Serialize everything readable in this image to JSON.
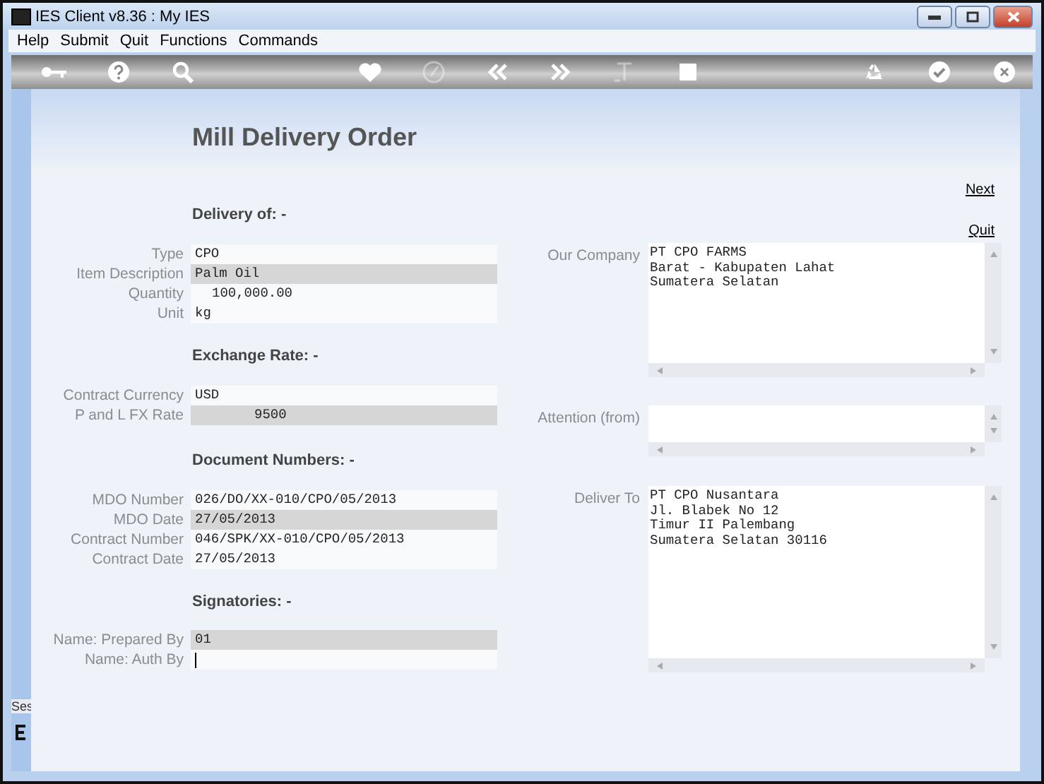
{
  "window": {
    "title": "IES Client v8.36 : My IES"
  },
  "menu": [
    "Help",
    "Submit",
    "Quit",
    "Functions",
    "Commands"
  ],
  "toolbar": [
    {
      "kind": "key",
      "disabled": false
    },
    {
      "kind": "help",
      "disabled": false
    },
    {
      "kind": "search",
      "disabled": false
    },
    {
      "kind": "heart",
      "disabled": false
    },
    {
      "kind": "clock",
      "disabled": true
    },
    {
      "kind": "back",
      "disabled": false
    },
    {
      "kind": "forward",
      "disabled": false
    },
    {
      "kind": "text",
      "disabled": true
    },
    {
      "kind": "stop",
      "disabled": false
    },
    {
      "kind": "recycle",
      "disabled": false
    },
    {
      "kind": "ok",
      "disabled": false
    },
    {
      "kind": "close",
      "disabled": false
    }
  ],
  "form": {
    "title": "Mill Delivery Order",
    "links": [
      "Next",
      "Quit"
    ],
    "sections": [
      {
        "heading": "Delivery of: -",
        "fields": [
          {
            "label": "Type",
            "value": "CPO",
            "kind": "text",
            "highlighted": false,
            "focused": false
          },
          {
            "label": "Item Description",
            "value": "Palm Oil",
            "kind": "text",
            "highlighted": true,
            "focused": false
          },
          {
            "label": "Quantity",
            "value": "100,000.00",
            "kind": "number",
            "highlighted": false,
            "focused": false
          },
          {
            "label": "Unit",
            "value": "kg",
            "kind": "text",
            "highlighted": false,
            "focused": false
          }
        ]
      },
      {
        "heading": "Exchange Rate: -",
        "fields": [
          {
            "label": "Contract Currency",
            "value": "USD",
            "kind": "text",
            "highlighted": false,
            "focused": false
          },
          {
            "label": "P and L  FX Rate",
            "value": "9500",
            "kind": "rate",
            "highlighted": true,
            "focused": false
          }
        ]
      },
      {
        "heading": "Document Numbers: -",
        "fields": [
          {
            "label": "MDO Number",
            "value": "026/DO/XX-010/CPO/05/2013",
            "kind": "text",
            "highlighted": false,
            "focused": false
          },
          {
            "label": "MDO Date",
            "value": "27/05/2013",
            "kind": "text",
            "highlighted": true,
            "focused": false
          },
          {
            "label": "Contract Number",
            "value": "046/SPK/XX-010/CPO/05/2013",
            "kind": "text",
            "highlighted": false,
            "focused": false
          },
          {
            "label": "Contract Date",
            "value": "27/05/2013",
            "kind": "text",
            "highlighted": false,
            "focused": false
          }
        ]
      },
      {
        "heading": "Signatories: -",
        "fields": [
          {
            "label": "Name: Prepared By",
            "value": "01",
            "kind": "text",
            "highlighted": true,
            "focused": false
          },
          {
            "label": "Name: Auth By",
            "kind": "text",
            "highlighted": false,
            "focused": true
          }
        ]
      }
    ],
    "memos": [
      {
        "label": "Our Company",
        "lines": [
          "PT CPO FARMS",
          "Barat - Kabupaten Lahat",
          "Sumatera Selatan"
        ]
      },
      {
        "label": "Attention (from)"
      },
      {
        "label": "Deliver To",
        "lines": [
          "PT CPO Nusantara",
          "Jl. Blabek No 12",
          "Timur II Palembang",
          "Sumatera Selatan 30116"
        ]
      }
    ]
  },
  "session": {
    "label": "Ses"
  }
}
